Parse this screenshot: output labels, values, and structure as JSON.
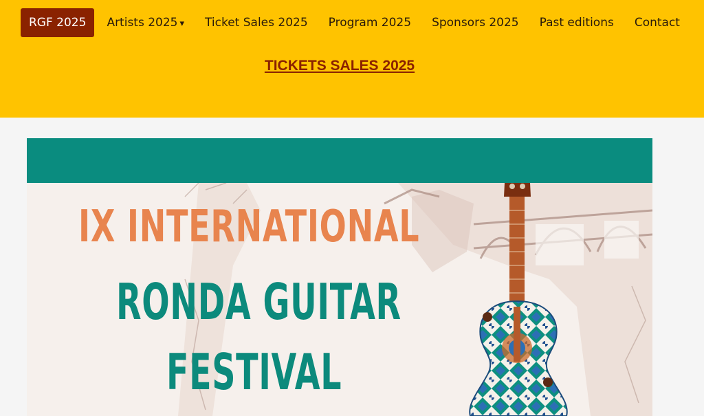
{
  "nav": {
    "items": [
      {
        "label": "RGF 2025",
        "active": true
      },
      {
        "label": "Artists 2025",
        "has_dropdown": true
      },
      {
        "label": "Ticket Sales 2025"
      },
      {
        "label": "Program 2025"
      },
      {
        "label": "Sponsors 2025"
      },
      {
        "label": "Past editions"
      },
      {
        "label": "Contact"
      }
    ],
    "dropdown_glyph": "▾"
  },
  "header": {
    "tickets_link": "TICKETS SALES 2025"
  },
  "poster": {
    "line_1": "IX INTERNATIONAL",
    "line_2": "RONDA GUITAR",
    "line_3": "FESTIVAL"
  },
  "colors": {
    "header_bg": "#ffc300",
    "nav_active_bg": "#8a2200",
    "link_color": "#8a2200",
    "poster_band": "#0a8c7f",
    "title_orange": "#e8844e",
    "title_teal": "#0c8a7c"
  }
}
